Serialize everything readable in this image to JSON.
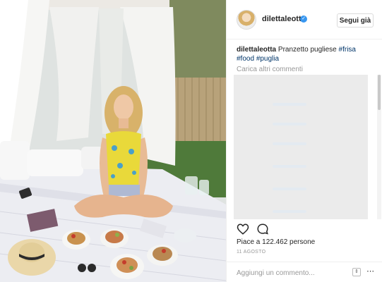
{
  "post": {
    "username": "dilettaleotta",
    "follow_label": "Segui già",
    "caption": {
      "author": "dilettaleotta",
      "text": "Pranzetto pugliese",
      "tags": [
        "#frisa",
        "#food",
        "#puglia"
      ]
    },
    "load_more_label": "Carica altri commenti",
    "likes_text": "Piace a 122.462 persone",
    "date": "11 AGOSTO",
    "comment_placeholder": "Aggiungi un commento..."
  },
  "icons": {
    "verified": "verified-badge-icon",
    "like": "heart-outline-icon",
    "comment": "speech-bubble-icon",
    "more": "up-down-arrows-icon",
    "options": "ellipsis-icon"
  },
  "colors": {
    "accent_blue": "#3897f0",
    "hashtag": "#003569",
    "muted": "#999999",
    "border": "#dbdbdb"
  }
}
